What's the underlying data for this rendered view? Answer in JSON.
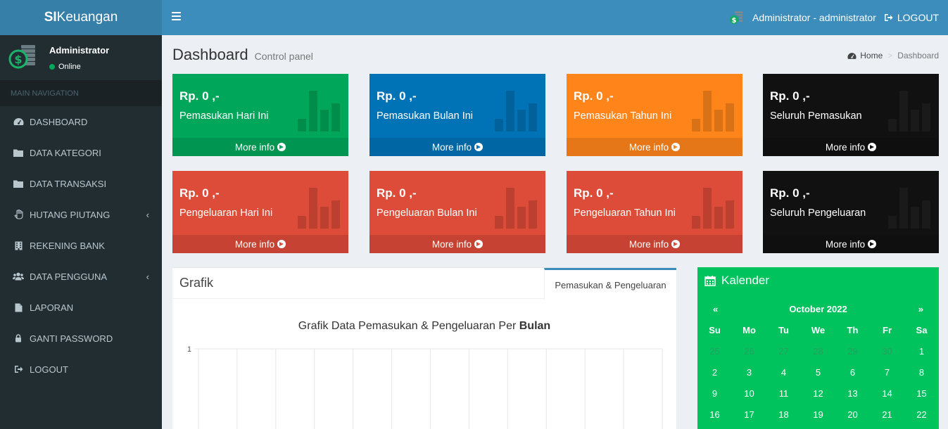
{
  "header": {
    "brand_bold": "SI",
    "brand_rest": "Keuangan",
    "user_label": "Administrator - administrator",
    "logout_label": "LOGOUT"
  },
  "sidebar": {
    "user_name": "Administrator",
    "user_status": "Online",
    "section_label": "MAIN NAVIGATION",
    "items": [
      {
        "label": "DASHBOARD",
        "icon": "dashboard-icon"
      },
      {
        "label": "DATA KATEGORI",
        "icon": "folder-icon"
      },
      {
        "label": "DATA TRANSAKSI",
        "icon": "folder-icon"
      },
      {
        "label": "HUTANG PIUTANG",
        "icon": "hand-icon"
      },
      {
        "label": "REKENING BANK",
        "icon": "building-icon"
      },
      {
        "label": "DATA PENGGUNA",
        "icon": "users-icon"
      },
      {
        "label": "LAPORAN",
        "icon": "file-icon"
      },
      {
        "label": "GANTI PASSWORD",
        "icon": "lock-icon"
      },
      {
        "label": "LOGOUT",
        "icon": "sign-out-icon"
      }
    ]
  },
  "content": {
    "title": "Dashboard",
    "subtitle": "Control panel",
    "breadcrumb_home": "Home",
    "breadcrumb_current": "Dashboard"
  },
  "boxes": [
    {
      "amount": "Rp. 0 ,-",
      "label": "Pemasukan Hari Ini",
      "footer": "More info",
      "color": "#00a65a"
    },
    {
      "amount": "Rp. 0 ,-",
      "label": "Pemasukan Bulan Ini",
      "footer": "More info",
      "color": "#0073b7"
    },
    {
      "amount": "Rp. 0 ,-",
      "label": "Pemasukan Tahun Ini",
      "footer": "More info",
      "color": "#ff851b"
    },
    {
      "amount": "Rp. 0 ,-",
      "label": "Seluruh Pemasukan",
      "footer": "More info",
      "color": "#111111"
    },
    {
      "amount": "Rp. 0 ,-",
      "label": "Pengeluaran Hari Ini",
      "footer": "More info",
      "color": "#dd4b39"
    },
    {
      "amount": "Rp. 0 ,-",
      "label": "Pengeluaran Bulan Ini",
      "footer": "More info",
      "color": "#dd4b39"
    },
    {
      "amount": "Rp. 0 ,-",
      "label": "Pengeluaran Tahun Ini",
      "footer": "More info",
      "color": "#dd4b39"
    },
    {
      "amount": "Rp. 0 ,-",
      "label": "Seluruh Pengeluaran",
      "footer": "More info",
      "color": "#111111"
    }
  ],
  "grafik": {
    "panel_title": "Grafik",
    "tab_label": "Pemasukan & Pengeluaran",
    "chart_title_prefix": "Grafik Data Pemasukan & Pengeluaran Per ",
    "chart_title_bold": "Bulan"
  },
  "chart_data": {
    "type": "bar",
    "title": "Grafik Data Pemasukan & Pengeluaran Per Bulan",
    "y_ticks": [
      "1"
    ],
    "ylim": [
      0,
      1
    ],
    "grid": true
  },
  "kalender": {
    "title": "Kalender",
    "prev": "«",
    "next": "»",
    "month": "October 2022",
    "days_of_week": [
      "Su",
      "Mo",
      "Tu",
      "We",
      "Th",
      "Fr",
      "Sa"
    ],
    "weeks": [
      [
        {
          "d": "25",
          "m": true
        },
        {
          "d": "26",
          "m": true
        },
        {
          "d": "27",
          "m": true
        },
        {
          "d": "28",
          "m": true
        },
        {
          "d": "29",
          "m": true
        },
        {
          "d": "30",
          "m": true
        },
        {
          "d": "1",
          "m": false
        }
      ],
      [
        {
          "d": "2",
          "m": false
        },
        {
          "d": "3",
          "m": false
        },
        {
          "d": "4",
          "m": false
        },
        {
          "d": "5",
          "m": false
        },
        {
          "d": "6",
          "m": false
        },
        {
          "d": "7",
          "m": false
        },
        {
          "d": "8",
          "m": false
        }
      ],
      [
        {
          "d": "9",
          "m": false
        },
        {
          "d": "10",
          "m": false
        },
        {
          "d": "11",
          "m": false
        },
        {
          "d": "12",
          "m": false
        },
        {
          "d": "13",
          "m": false
        },
        {
          "d": "14",
          "m": false
        },
        {
          "d": "15",
          "m": false
        }
      ],
      [
        {
          "d": "16",
          "m": false
        },
        {
          "d": "17",
          "m": false
        },
        {
          "d": "18",
          "m": false
        },
        {
          "d": "19",
          "m": false
        },
        {
          "d": "20",
          "m": false
        },
        {
          "d": "21",
          "m": false
        },
        {
          "d": "22",
          "m": false
        }
      ]
    ]
  }
}
